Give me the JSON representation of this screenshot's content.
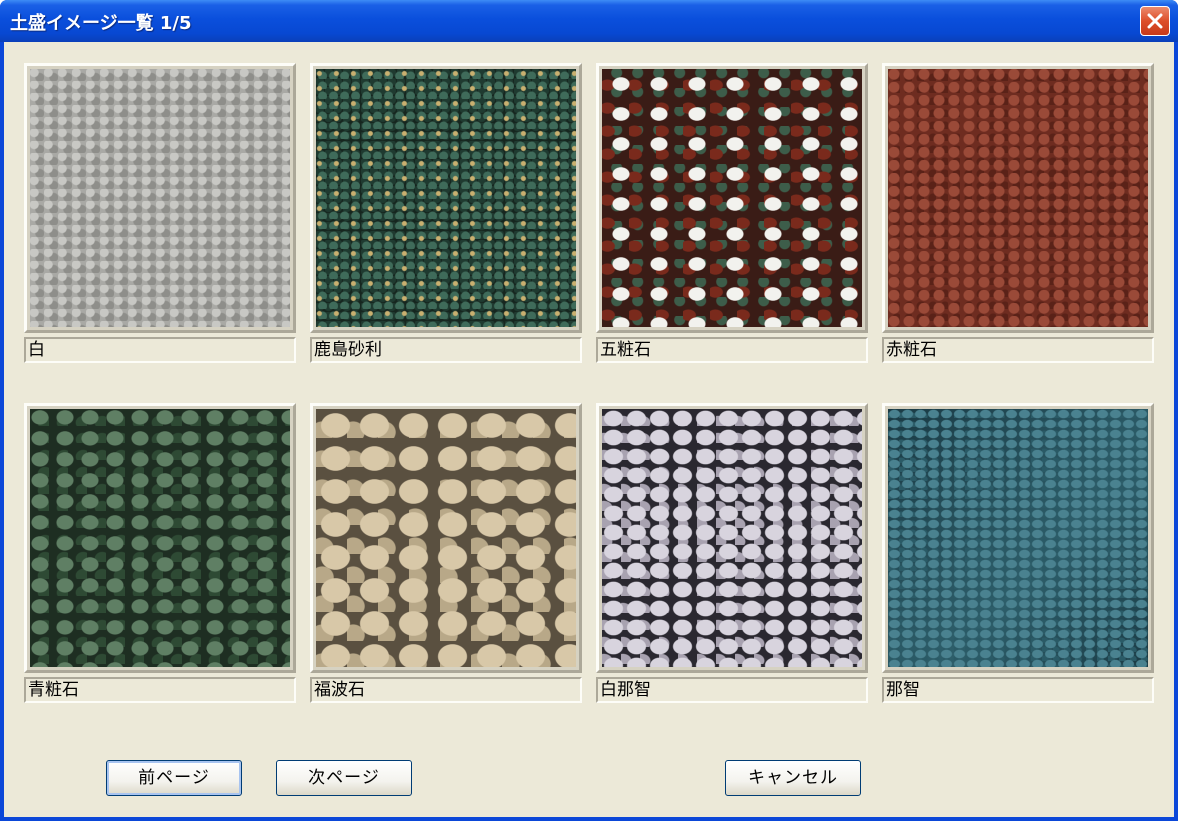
{
  "window": {
    "title": "土盛イメージ一覧 1/5"
  },
  "grid": {
    "tiles": [
      {
        "label": "白"
      },
      {
        "label": "鹿島砂利"
      },
      {
        "label": "五粧石"
      },
      {
        "label": "赤粧石"
      },
      {
        "label": "青粧石"
      },
      {
        "label": "福波石"
      },
      {
        "label": "白那智"
      },
      {
        "label": "那智"
      }
    ]
  },
  "buttons": {
    "prev": "前ページ",
    "next": "次ページ",
    "cancel": "キャンセル"
  }
}
